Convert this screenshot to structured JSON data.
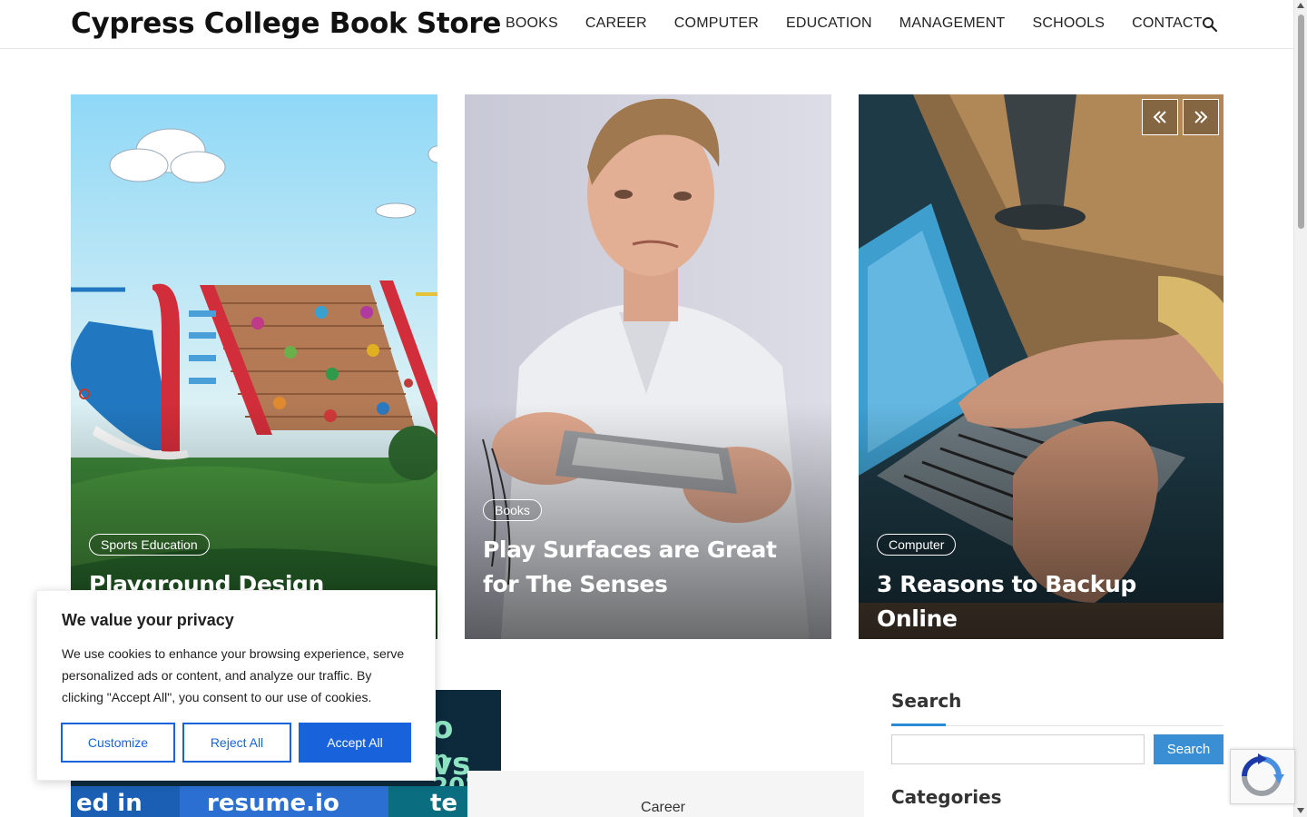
{
  "site": {
    "title": "Cypress College Book Store"
  },
  "nav": {
    "items": [
      "BOOKS",
      "CAREER",
      "COMPUTER",
      "EDUCATION",
      "MANAGEMENT",
      "SCHOOLS",
      "CONTACT"
    ]
  },
  "slider": {
    "prev_icon": "double-chevron-left-icon",
    "next_icon": "double-chevron-right-icon",
    "cards": [
      {
        "category": "Sports Education",
        "title": "Playground Design",
        "image": "playground-illustration"
      },
      {
        "category": "Books",
        "title": "Play Surfaces are Great for The Senses",
        "image": "man-holding-device-photo"
      },
      {
        "category": "Computer",
        "title": "3 Reasons to Backup Online",
        "image": "laptop-typing-photo"
      }
    ]
  },
  "promo": {
    "heading_fragment": "o vs T",
    "year_fragment": "n 2026",
    "logos": [
      "ed in",
      "resume.io",
      "te"
    ]
  },
  "post_meta": {
    "category": "Career"
  },
  "sidebar": {
    "search": {
      "title": "Search",
      "placeholder": "",
      "button": "Search"
    },
    "categories": {
      "title": "Categories"
    }
  },
  "cookie_banner": {
    "title": "We value your privacy",
    "text": "We use cookies to enhance your browsing experience, serve personalized ads or content, and analyze our traffic. By clicking \"Accept All\", you consent to our use of cookies.",
    "customize": "Customize",
    "reject": "Reject All",
    "accept": "Accept All"
  },
  "colors": {
    "accent": "#1863dc",
    "sidebar_accent": "#3a8fd4",
    "promo_bg": "#0c2a3c"
  }
}
